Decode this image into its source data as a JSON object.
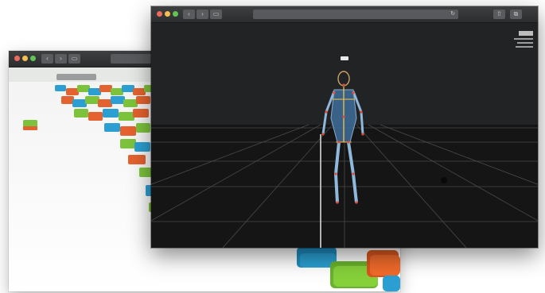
{
  "colors": {
    "accent_red": "#ed6a5e",
    "accent_yellow": "#f5bf4f",
    "accent_green": "#61c554"
  },
  "back_window": {
    "url_text": "",
    "toolbar_icons": [
      "back-arrow-icon",
      "forward-arrow-icon",
      "sidebar-icon"
    ],
    "scene_description_icons": [
      "box-icon"
    ]
  },
  "front_window": {
    "url_text": "",
    "reload_glyph": "↻",
    "toolbar_icons": [
      "back-arrow-icon",
      "forward-arrow-icon",
      "sidebar-icon",
      "share-icon",
      "tabs-icon"
    ],
    "label_above_figure": "",
    "info_panel_lines": [
      "",
      "",
      ""
    ]
  }
}
